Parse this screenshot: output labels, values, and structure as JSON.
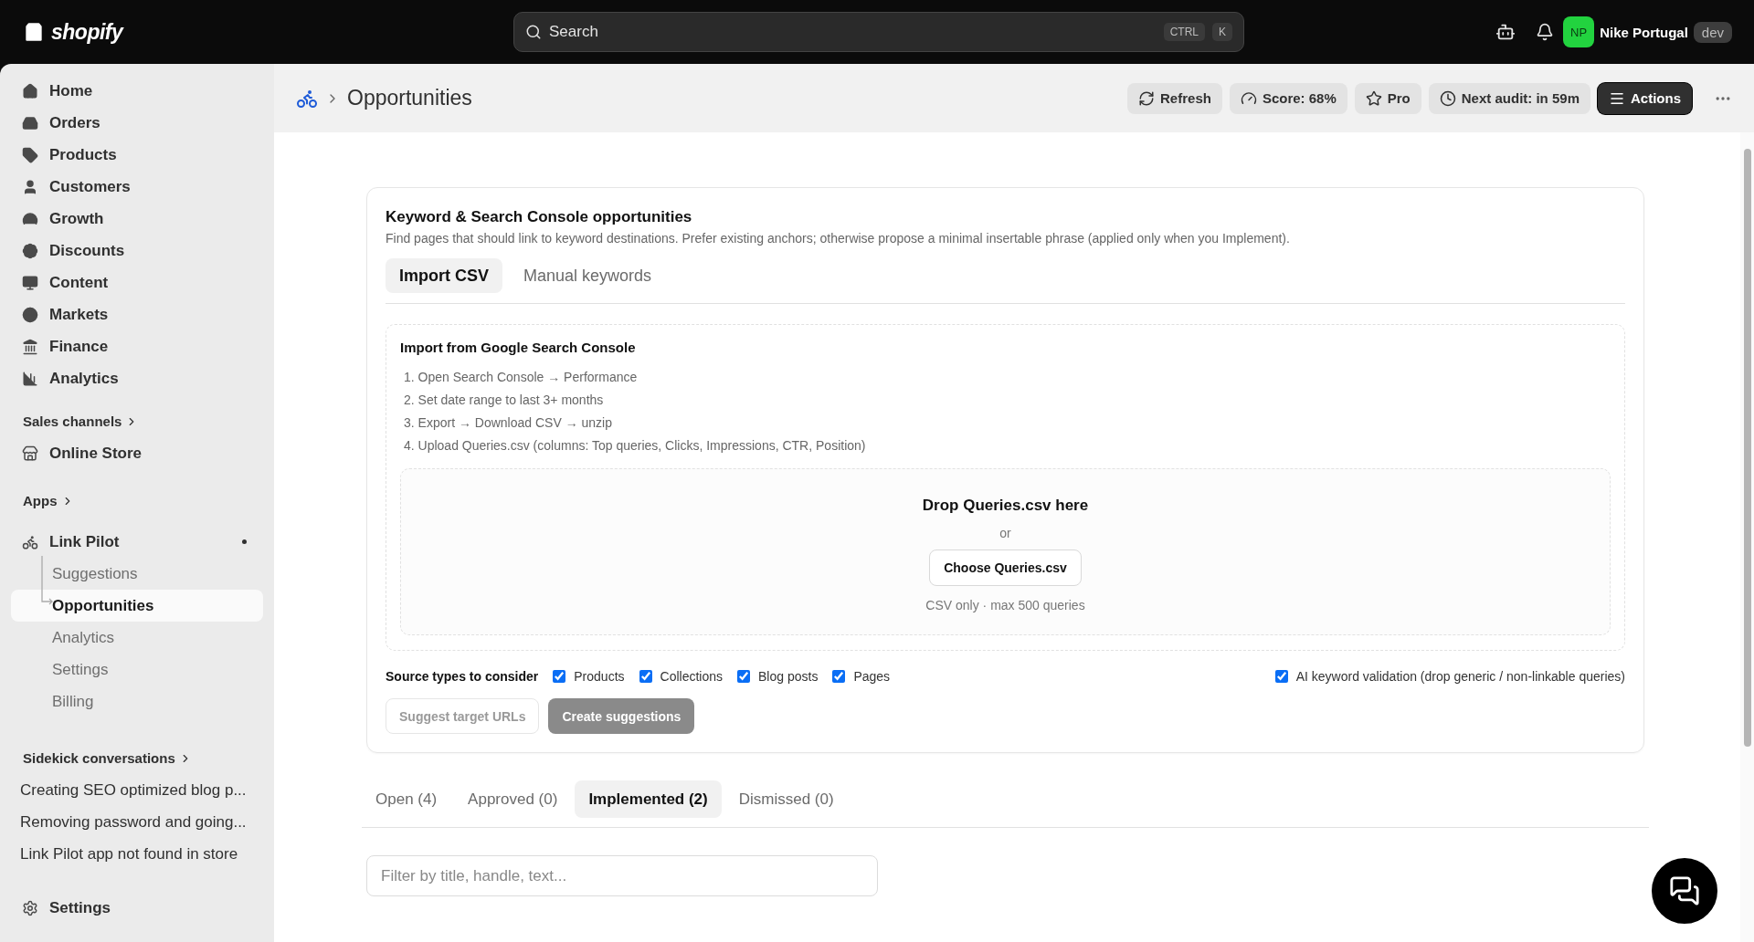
{
  "topbar": {
    "logo": "shopify",
    "search": {
      "placeholder": "Search",
      "keys": [
        "CTRL",
        "K"
      ]
    },
    "avatar": "NP",
    "store": "Nike Portugal",
    "badge": "dev"
  },
  "sidebar": {
    "nav": [
      {
        "label": "Home",
        "selected": false
      },
      {
        "label": "Orders",
        "selected": false
      },
      {
        "label": "Products",
        "selected": false
      },
      {
        "label": "Customers",
        "selected": false
      },
      {
        "label": "Growth",
        "selected": false
      },
      {
        "label": "Discounts",
        "selected": false
      },
      {
        "label": "Content",
        "selected": false
      },
      {
        "label": "Markets",
        "selected": false
      },
      {
        "label": "Finance",
        "selected": false
      },
      {
        "label": "Analytics",
        "selected": false
      }
    ],
    "sales_channels": {
      "heading": "Sales channels",
      "items": [
        {
          "label": "Online Store",
          "selected": false
        }
      ]
    },
    "apps": {
      "heading": "Apps",
      "app": {
        "label": "Link Pilot",
        "children": [
          {
            "label": "Suggestions",
            "selected": false
          },
          {
            "label": "Opportunities",
            "selected": true
          },
          {
            "label": "Analytics",
            "selected": false
          },
          {
            "label": "Settings",
            "selected": false
          },
          {
            "label": "Billing",
            "selected": false
          }
        ]
      }
    },
    "sidekick": {
      "heading": "Sidekick conversations",
      "items": [
        "Creating SEO optimized blog p...",
        "Removing password and going...",
        "Link Pilot app not found in store"
      ]
    },
    "settings": "Settings"
  },
  "header": {
    "title": "Opportunities",
    "buttons": [
      {
        "label": "Refresh",
        "kind": "plain"
      },
      {
        "label": "Score: 68%",
        "kind": "plain"
      },
      {
        "label": "Pro",
        "kind": "plain"
      },
      {
        "label": "Next audit: in 59m",
        "kind": "plain"
      },
      {
        "label": "Actions",
        "kind": "primary"
      }
    ]
  },
  "card": {
    "title": "Keyword & Search Console opportunities",
    "description": "Find pages that should link to keyword destinations. Prefer existing anchors; otherwise propose a minimal insertable phrase (applied only when you Implement).",
    "tabs": [
      {
        "label": "Import CSV",
        "selected": true
      },
      {
        "label": "Manual keywords",
        "selected": false
      }
    ],
    "import": {
      "title": "Import from Google Search Console",
      "steps": [
        "1. Open Search Console → Performance",
        "2. Set date range to last 3+ months",
        "3. Export → Download CSV → unzip",
        "4. Upload Queries.csv (columns: Top queries, Clicks, Impressions, CTR, Position)"
      ],
      "dropzone": {
        "title": "Drop Queries.csv here",
        "or": "or",
        "button": "Choose Queries.csv",
        "note": "CSV only · max 500 queries"
      }
    },
    "source_types": {
      "label": "Source types to consider",
      "options": [
        {
          "label": "Products",
          "checked": true
        },
        {
          "label": "Collections",
          "checked": true
        },
        {
          "label": "Blog posts",
          "checked": true
        },
        {
          "label": "Pages",
          "checked": true
        }
      ]
    },
    "ai_validation": {
      "label": "AI keyword validation (drop generic / non-linkable queries)",
      "checked": true
    },
    "buttons": [
      {
        "label": "Suggest target URLs",
        "kind": "secondary",
        "disabled": true
      },
      {
        "label": "Create suggestions",
        "kind": "primary",
        "disabled": true
      }
    ]
  },
  "results": {
    "tabs": [
      {
        "label": "Open (4)",
        "selected": false
      },
      {
        "label": "Approved (0)",
        "selected": false
      },
      {
        "label": "Implemented (2)",
        "selected": true
      },
      {
        "label": "Dismissed (0)",
        "selected": false
      }
    ],
    "filter": {
      "placeholder": "Filter by title, handle, text..."
    }
  }
}
